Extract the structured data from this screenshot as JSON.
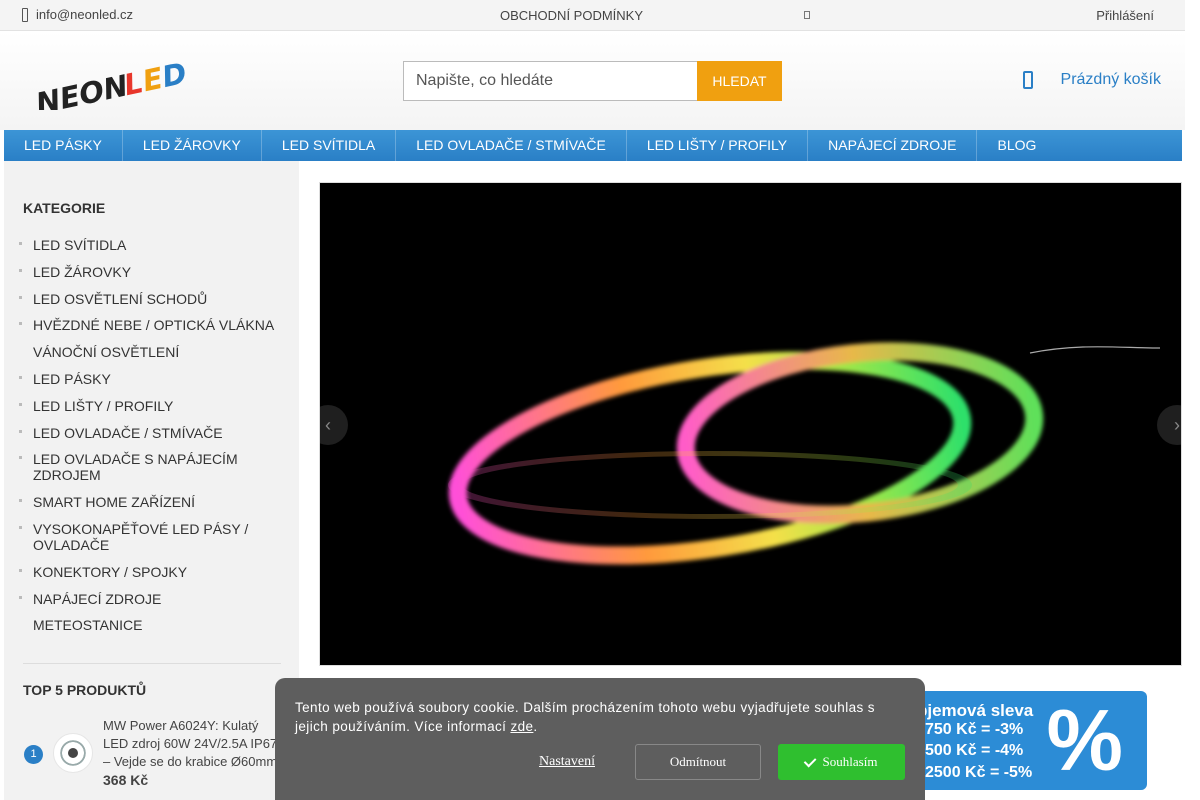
{
  "topbar": {
    "email": "info@neonled.cz",
    "terms": "OBCHODNÍ PODMÍNKY",
    "login": "Přihlášení"
  },
  "header": {
    "logo_text": "NEONLED",
    "search_placeholder": "Napište, co hledáte",
    "search_button": "HLEDAT",
    "cart_label": "Prázdný košík"
  },
  "nav": {
    "items": [
      "LED PÁSKY",
      "LED ŽÁROVKY",
      "LED SVÍTIDLA",
      "LED OVLADAČE / STMÍVAČE",
      "LED LIŠTY / PROFILY",
      "NAPÁJECÍ ZDROJE",
      "BLOG"
    ]
  },
  "sidebar": {
    "title": "KATEGORIE",
    "categories": [
      "LED SVÍTIDLA",
      "LED ŽÁROVKY",
      "LED OSVĚTLENÍ SCHODŮ",
      "HVĚZDNÉ NEBE / OPTICKÁ VLÁKNA",
      "VÁNOČNÍ OSVĚTLENÍ",
      "LED PÁSKY",
      "LED LIŠTY / PROFILY",
      "LED OVLADAČE / STMÍVAČE",
      "LED OVLADAČE S NAPÁJECÍM ZDROJEM",
      "SMART HOME ZAŘÍZENÍ",
      "VYSOKONAPĚŤOVÉ LED PÁSY / OVLADAČE",
      "KONEKTORY / SPOJKY",
      "NAPÁJECÍ ZDROJE",
      "METEOSTANICE"
    ],
    "top5_title": "TOP 5 PRODUKTŮ",
    "top_product": {
      "rank": "1",
      "name": "MW Power A6024Y: Kulatý LED zdroj 60W 24V/2.5A IP67 – Vejde se do krabice Ø60mm",
      "price": "368 Kč"
    }
  },
  "slider": {
    "prev": "‹",
    "next": "›"
  },
  "banner": {
    "head": "bjemová sleva",
    "lines": [
      "750 Kč = -3%",
      "500 Kč = -4%",
      "2500 Kč = -5%"
    ],
    "pct": "%"
  },
  "cookie": {
    "message": "Tento web používá soubory cookie. Dalším procházením tohoto webu vyjadřujete souhlas s jejich používáním. Více informací ",
    "link": "zde",
    "link_after": ".",
    "settings": "Nastavení",
    "reject": "Odmítnout",
    "accept": "Souhlasím"
  },
  "colors": {
    "brand_blue": "#2a7fc6",
    "search_button": "#f0a010",
    "accept_green": "#2fbf2f",
    "cookie_bg": "#5e5e5e"
  },
  "icons": [
    "phone-icon",
    "cart-icon",
    "check-icon",
    "chevron-left-icon",
    "chevron-right-icon"
  ]
}
